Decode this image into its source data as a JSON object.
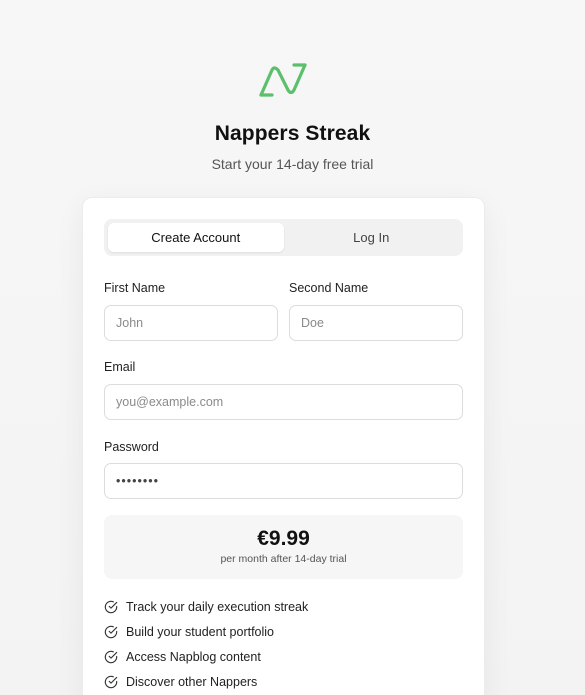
{
  "app": {
    "title": "Nappers Streak",
    "subtitle": "Start your 14-day free trial",
    "accent_color": "#5bbf6c"
  },
  "tabs": [
    {
      "label": "Create Account",
      "active": true
    },
    {
      "label": "Log In",
      "active": false
    }
  ],
  "form": {
    "first_name": {
      "label": "First Name",
      "placeholder": "John",
      "value": ""
    },
    "second_name": {
      "label": "Second Name",
      "placeholder": "Doe",
      "value": ""
    },
    "email": {
      "label": "Email",
      "placeholder": "you@example.com",
      "value": ""
    },
    "password": {
      "label": "Password",
      "value": "••••••••"
    }
  },
  "pricing": {
    "price": "€9.99",
    "note": "per month after 14-day trial"
  },
  "features": [
    "Track your daily execution streak",
    "Build your student portfolio",
    "Access Napblog content",
    "Discover other Nappers"
  ],
  "icons": {
    "logo": "lightning-n-logo-icon",
    "feature": "check-circle-icon"
  }
}
